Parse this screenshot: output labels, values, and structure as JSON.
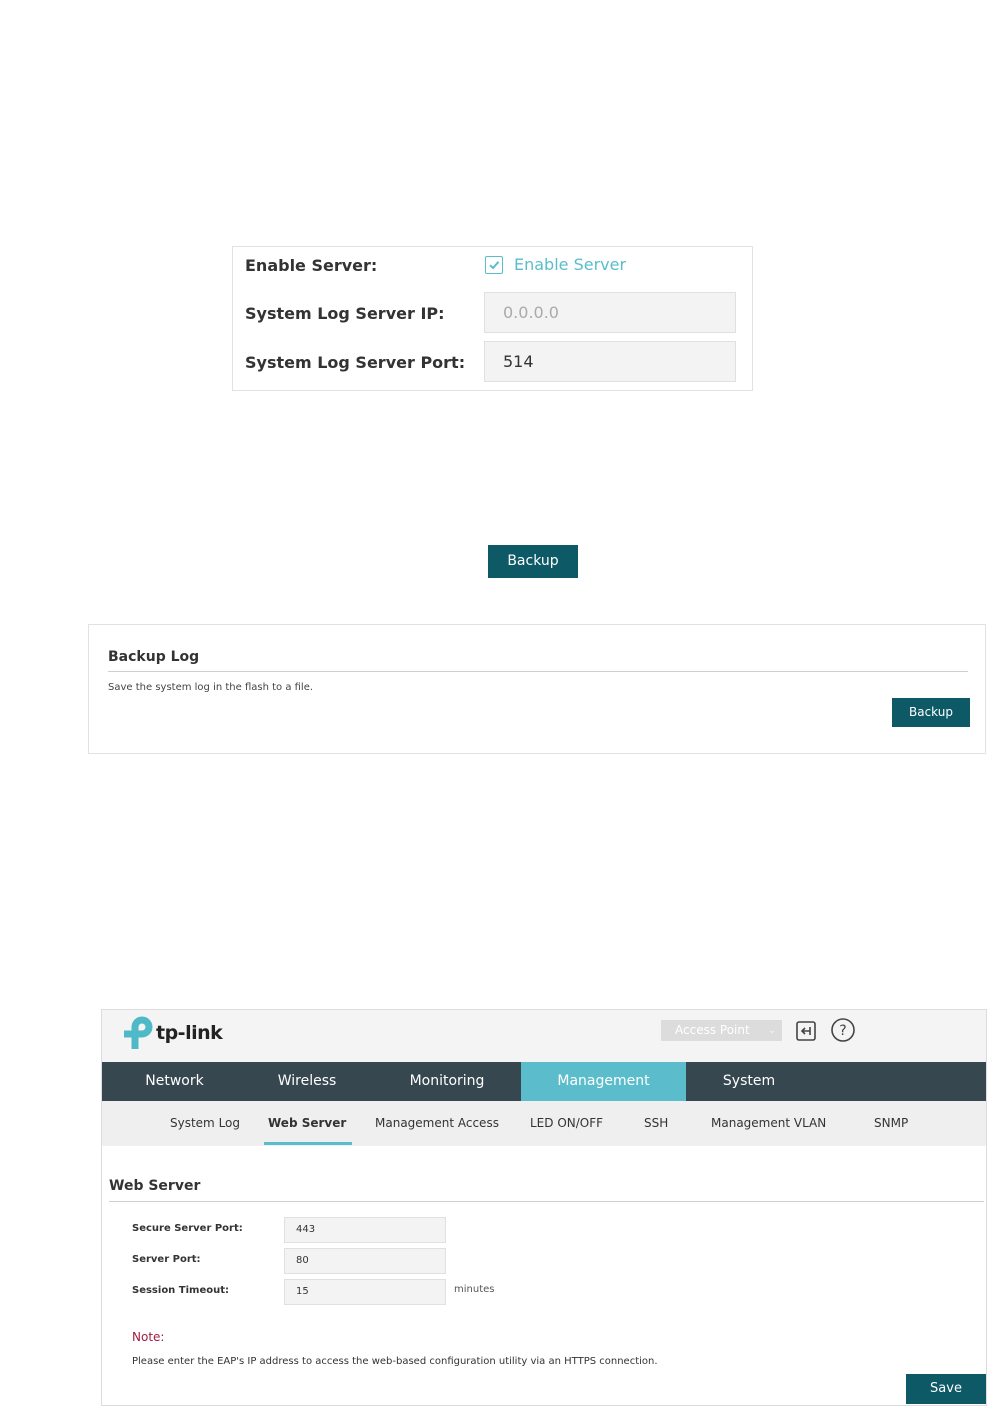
{
  "syslog": {
    "enable_label": "Enable Server:",
    "enable_checkbox_label": "Enable Server",
    "enable_checked": true,
    "ip_label": "System Log Server IP:",
    "ip_value": "0.0.0.0",
    "port_label": "System Log Server Port:",
    "port_value": "514"
  },
  "standalone_backup": {
    "label": "Backup"
  },
  "backup_log": {
    "title": "Backup Log",
    "description": "Save the system log in the flash to a file.",
    "button_label": "Backup"
  },
  "web_ui": {
    "logo_text": "tp-link",
    "mode_select": "Access Point",
    "main_nav": [
      "Network",
      "Wireless",
      "Monitoring",
      "Management",
      "System"
    ],
    "active_main_tab": "Management",
    "sub_nav": [
      "System Log",
      "Web Server",
      "Management Access",
      "LED ON/OFF",
      "SSH",
      "Management VLAN",
      "SNMP"
    ],
    "active_sub_tab": "Web Server",
    "section_title": "Web Server",
    "fields": {
      "secure_port_label": "Secure Server Port:",
      "secure_port_value": "443",
      "server_port_label": "Server Port:",
      "server_port_value": "80",
      "session_timeout_label": "Session Timeout:",
      "session_timeout_value": "15",
      "session_timeout_unit": "minutes"
    },
    "note_label": "Note:",
    "note_text": "Please enter the EAP's IP address to access the web-based configuration utility via an HTTPS connection.",
    "save_label": "Save",
    "colors": {
      "accent": "#5bbdcb",
      "nav_bg": "#37474f",
      "button_bg": "#0d5a66",
      "note": "#a01c3c"
    }
  }
}
